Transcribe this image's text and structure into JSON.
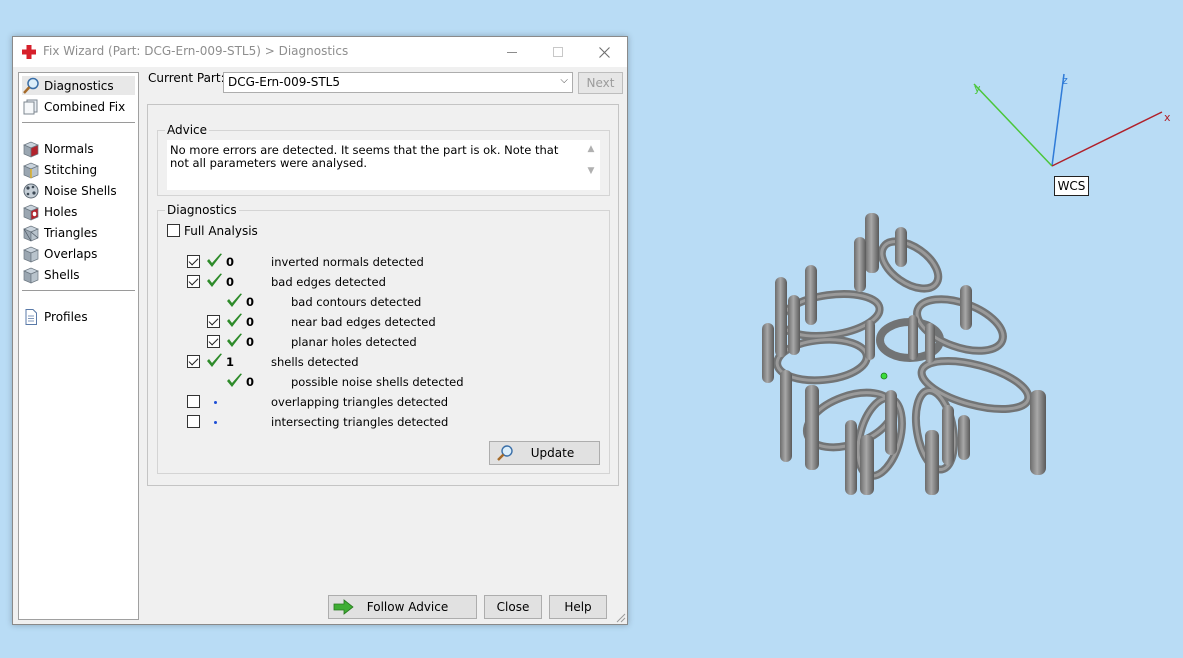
{
  "window": {
    "title": "Fix Wizard (Part: DCG-Ern-009-STL5) > Diagnostics"
  },
  "nav": {
    "items": [
      {
        "label": "Diagnostics",
        "icon": "diagnostics-magnifier-icon",
        "selected": true
      },
      {
        "label": "Combined Fix",
        "icon": "combined-fix-icon"
      },
      {
        "label": "Normals",
        "icon": "normals-cube-icon"
      },
      {
        "label": "Stitching",
        "icon": "stitching-cube-icon"
      },
      {
        "label": "Noise Shells",
        "icon": "noise-shells-icon"
      },
      {
        "label": "Holes",
        "icon": "holes-cube-icon"
      },
      {
        "label": "Triangles",
        "icon": "triangles-cube-icon"
      },
      {
        "label": "Overlaps",
        "icon": "overlaps-cube-icon"
      },
      {
        "label": "Shells",
        "icon": "shells-cube-icon"
      },
      {
        "label": "Profiles",
        "icon": "profiles-document-icon"
      }
    ]
  },
  "part": {
    "label": "Current Part:",
    "value": "DCG-Ern-009-STL5",
    "next_label": "Next"
  },
  "advice": {
    "title": "Advice",
    "text": "No more errors are detected. It seems that the part is ok. Note that not all parameters were analysed."
  },
  "diagnostics": {
    "title": "Diagnostics",
    "full_analysis_label": "Full Analysis",
    "rows": [
      {
        "checkbox": "checked",
        "status": "ok",
        "count": "0",
        "label": "inverted normals detected"
      },
      {
        "checkbox": "checked",
        "status": "ok",
        "count": "0",
        "label": "bad edges detected"
      },
      {
        "checkbox": "none",
        "status": "ok",
        "count": "0",
        "label": "bad contours detected"
      },
      {
        "checkbox": "checked",
        "status": "ok",
        "count": "0",
        "label": "near bad edges detected"
      },
      {
        "checkbox": "checked",
        "status": "ok",
        "count": "0",
        "label": "planar holes detected"
      },
      {
        "checkbox": "checked",
        "status": "ok",
        "count": "1",
        "label": "shells detected"
      },
      {
        "checkbox": "none",
        "status": "ok",
        "count": "0",
        "label": "possible noise shells detected"
      },
      {
        "checkbox": "unchecked",
        "status": "pending",
        "count": "",
        "label": "overlapping triangles detected"
      },
      {
        "checkbox": "unchecked",
        "status": "pending",
        "count": "",
        "label": "intersecting triangles detected"
      }
    ],
    "update_label": "Update"
  },
  "footer": {
    "follow_advice_label": "Follow Advice",
    "close_label": "Close",
    "help_label": "Help"
  },
  "viewport": {
    "wcs_label": "WCS",
    "axes": {
      "x": "x",
      "y": "y",
      "z": "z"
    },
    "colors": {
      "background": "#b9dcf5",
      "x_axis": "#b0202a",
      "y_axis": "#4bc63a",
      "z_axis": "#2f7bd8",
      "model": "#8a8a8a"
    }
  }
}
